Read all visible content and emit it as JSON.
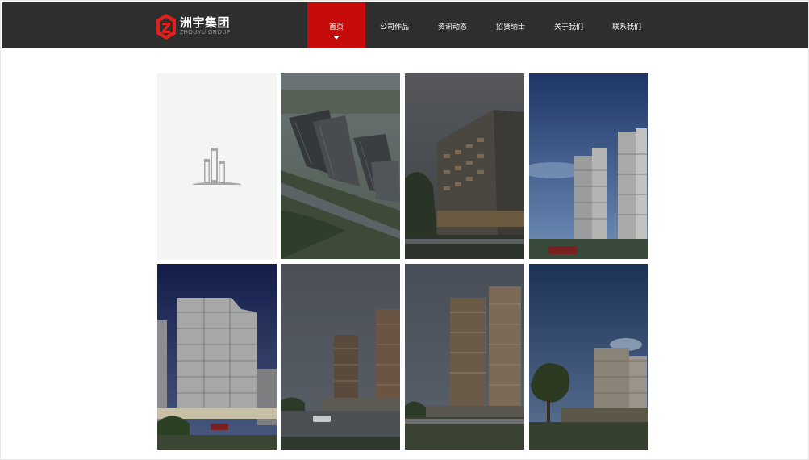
{
  "brand": {
    "name": "洲宇集团",
    "subtitle": "ZHOUYU GROUP",
    "logo_color": "#e0201c"
  },
  "nav": {
    "items": [
      {
        "label": "首页",
        "active": true
      },
      {
        "label": "公司作品",
        "active": false
      },
      {
        "label": "资讯动态",
        "active": false
      },
      {
        "label": "招贤纳士",
        "active": false
      },
      {
        "label": "关于我们",
        "active": false
      },
      {
        "label": "联系我们",
        "active": false
      }
    ],
    "active_color": "#c60b0b",
    "bar_color": "#2e2e2e"
  },
  "gallery": {
    "tiles": [
      {
        "kind": "placeholder",
        "icon": "building-placeholder-icon"
      },
      {
        "kind": "photo",
        "subject": "aerial residential towers"
      },
      {
        "kind": "photo",
        "subject": "mid-rise apartment at dusk"
      },
      {
        "kind": "photo",
        "subject": "high-rise towers blue sky"
      },
      {
        "kind": "photo",
        "subject": "residential tower night sky"
      },
      {
        "kind": "photo",
        "subject": "towers with street"
      },
      {
        "kind": "photo",
        "subject": "twin towers plaza"
      },
      {
        "kind": "photo",
        "subject": "tower with trees"
      }
    ]
  }
}
